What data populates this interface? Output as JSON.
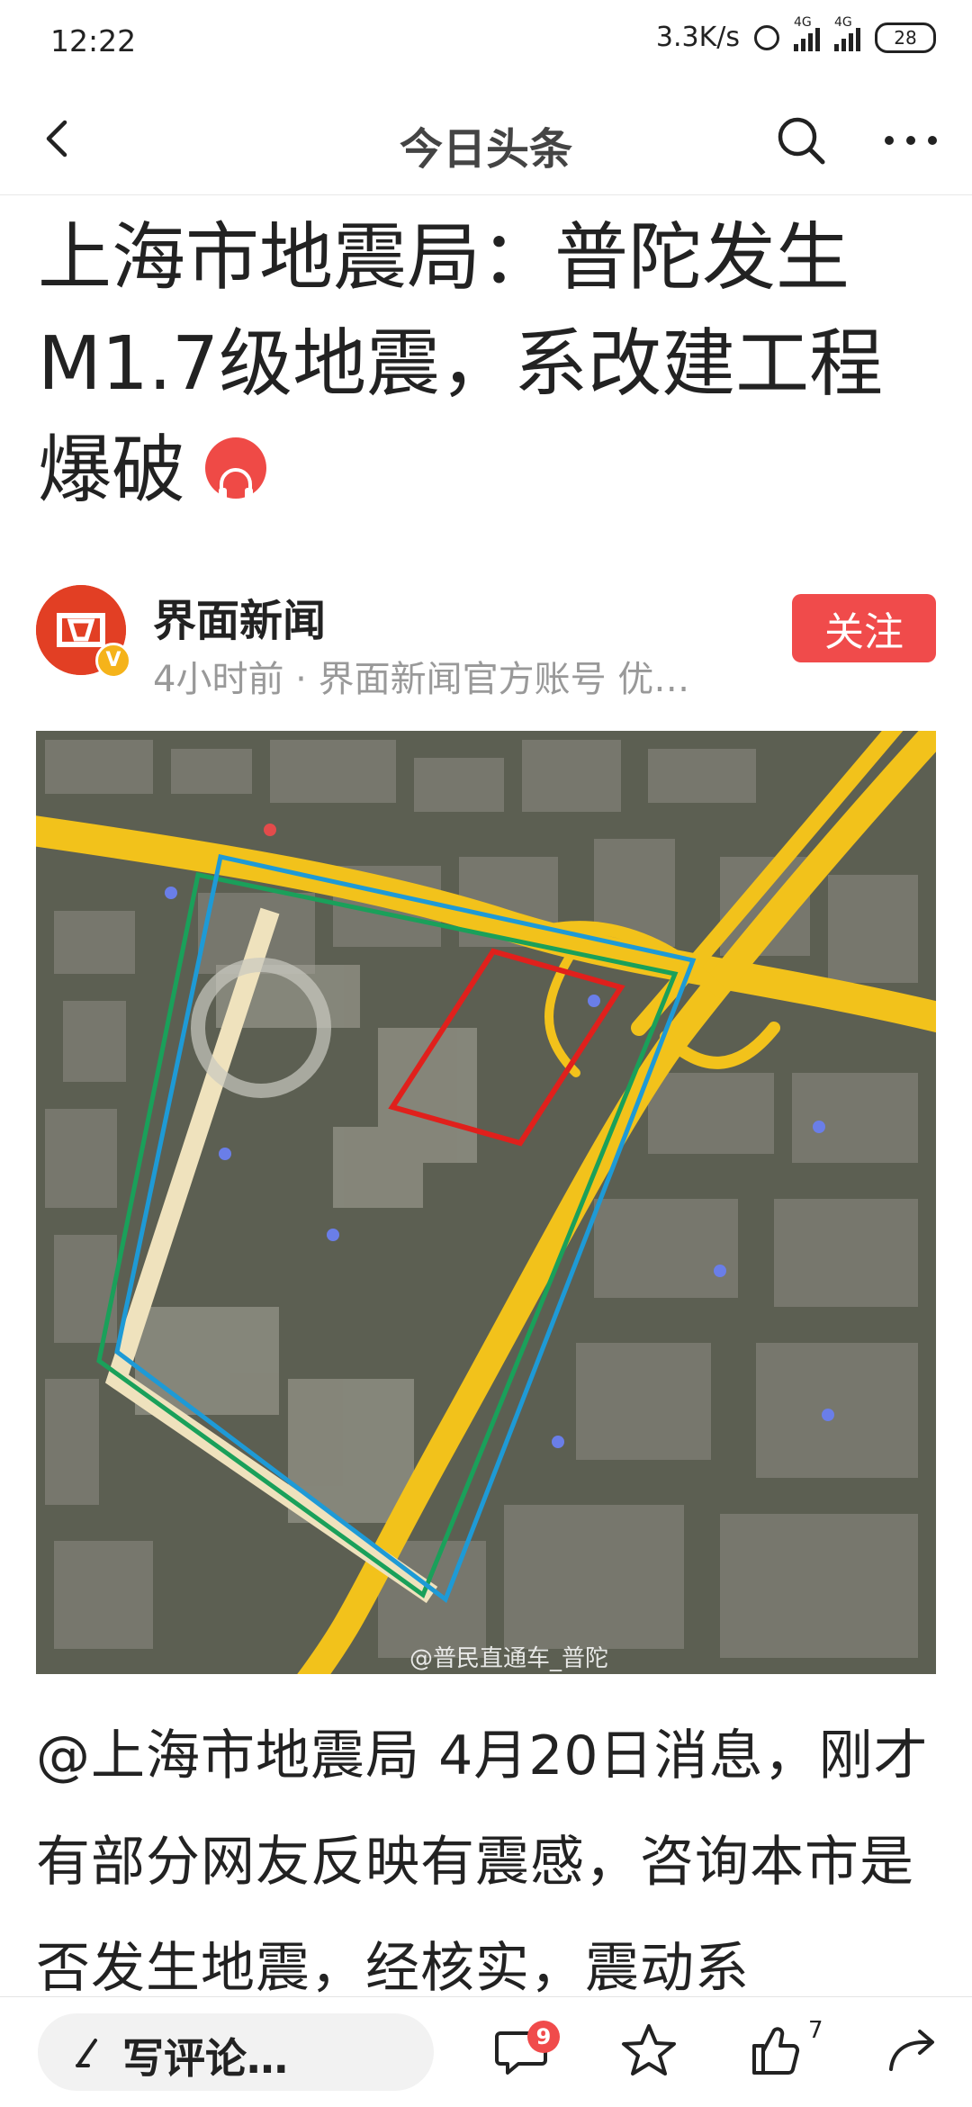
{
  "status_bar": {
    "time": "12:22",
    "net_speed": "3.3K/s",
    "sim1_label": "4G",
    "sim2_label": "4G",
    "battery": "28"
  },
  "nav": {
    "title": "今日头条",
    "icons": [
      "back-icon",
      "search-icon",
      "more-icon"
    ]
  },
  "article": {
    "headline": "上海市地震局：普陀发生M1.7级地震，系改建工程爆破",
    "author": {
      "name": "界面新闻",
      "meta": "4小时前 · 界面新闻官方账号 优…",
      "follow_label": "关注"
    },
    "image_watermark": "@普民直通车_普陀",
    "body": "@上海市地震局 4月20日消息，刚才有部分网友反映有震感，咨询本市是否发生地震，经核实，震动系"
  },
  "bottom_bar": {
    "comment_placeholder": "写评论…",
    "comment_count": "9",
    "like_count": "7"
  },
  "colors": {
    "accent_red": "#f04b4b",
    "road_yellow": "#f2c21b",
    "outline_green": "#1aa05a",
    "outline_blue": "#1e9ad6",
    "outline_red": "#e0201c"
  }
}
